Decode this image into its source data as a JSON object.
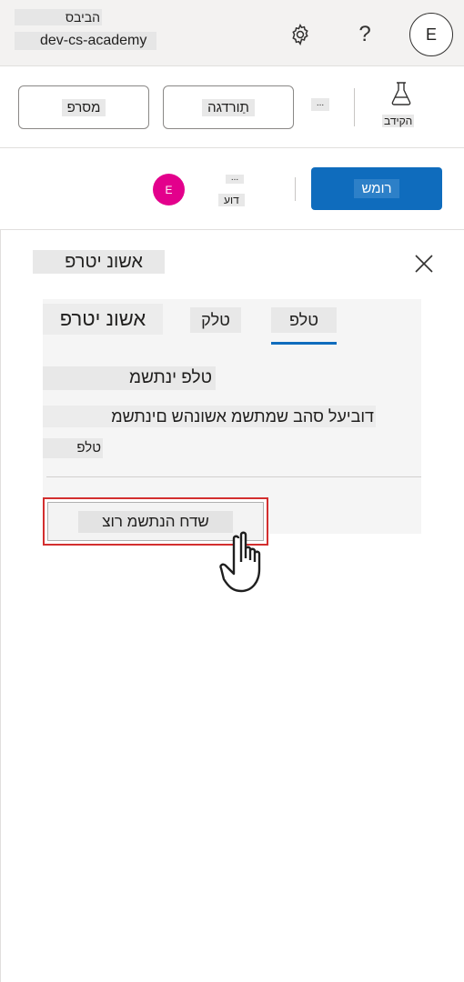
{
  "topbar": {
    "environment_label": "הביבס",
    "environment_name": "dev-cs-academy",
    "settings_icon": "gear-icon",
    "help_label": "?",
    "avatar_initial": "E"
  },
  "commandbar": {
    "publish_label": "מסרפ",
    "share_label": "תַורדגה",
    "more_label": "...",
    "test_label": "הקידב",
    "test_icon": "flask-icon"
  },
  "actions": {
    "save_label": "רומש",
    "more_dots": "...",
    "more_label": "דוע",
    "user_initial": "E",
    "user_color": "#e3008c",
    "primary_color": "#0f6cbd"
  },
  "panel": {
    "title": "אשונ יטרפ",
    "tabs": [
      {
        "label": "טלפ",
        "selected": true
      },
      {
        "label": "טלק",
        "selected": false
      },
      {
        "label": "אשונ יטרפ",
        "selected": false
      }
    ],
    "content": {
      "line1": "טלפ ינתשמ",
      "line2": "דוביעל סהב שמתשמ אשונהש םינתשמ",
      "line3": "טלפ"
    },
    "create_button_label": "שדח הנתשמ רוצ",
    "highlight_color": "#d32f2f"
  }
}
